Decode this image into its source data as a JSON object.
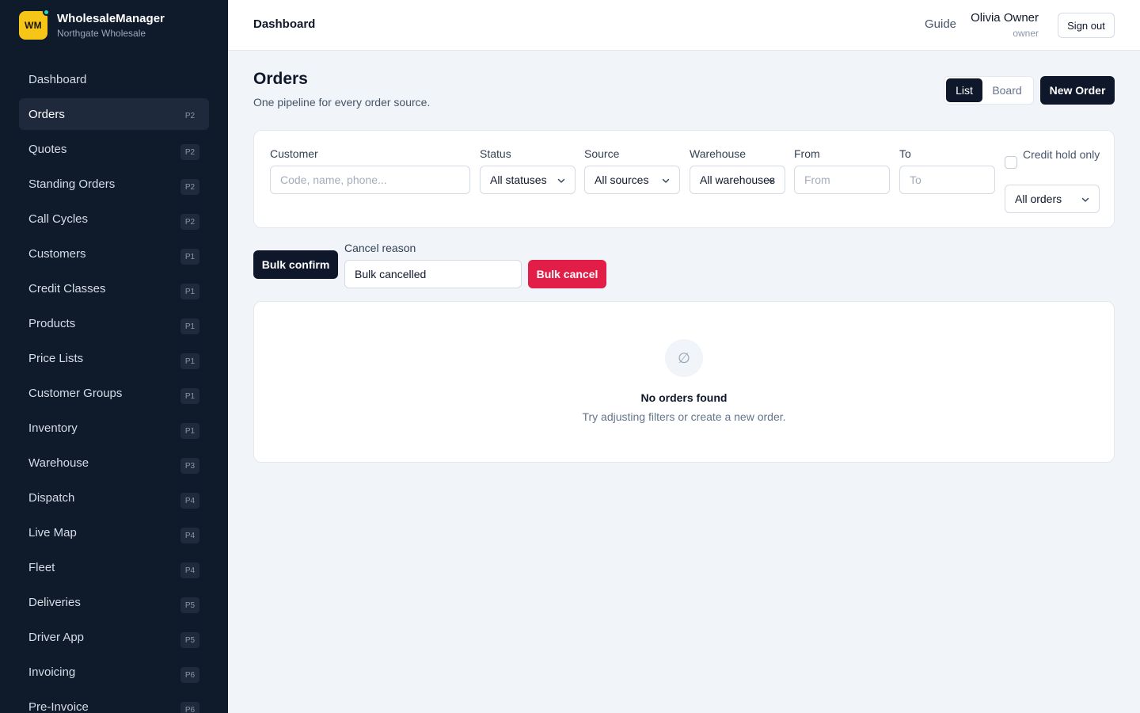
{
  "brand": {
    "logo_text": "WM",
    "name": "WholesaleManager",
    "subtitle": "Northgate Wholesale"
  },
  "sidebar": {
    "items": [
      {
        "label": "Dashboard",
        "badge": ""
      },
      {
        "label": "Orders",
        "badge": "P2",
        "active": true
      },
      {
        "label": "Quotes",
        "badge": "P2"
      },
      {
        "label": "Standing Orders",
        "badge": "P2"
      },
      {
        "label": "Call Cycles",
        "badge": "P2"
      },
      {
        "label": "Customers",
        "badge": "P1"
      },
      {
        "label": "Credit Classes",
        "badge": "P1"
      },
      {
        "label": "Products",
        "badge": "P1"
      },
      {
        "label": "Price Lists",
        "badge": "P1"
      },
      {
        "label": "Customer Groups",
        "badge": "P1"
      },
      {
        "label": "Inventory",
        "badge": "P1"
      },
      {
        "label": "Warehouse",
        "badge": "P3"
      },
      {
        "label": "Dispatch",
        "badge": "P4"
      },
      {
        "label": "Live Map",
        "badge": "P4"
      },
      {
        "label": "Fleet",
        "badge": "P4"
      },
      {
        "label": "Deliveries",
        "badge": "P5"
      },
      {
        "label": "Driver App",
        "badge": "P5"
      },
      {
        "label": "Invoicing",
        "badge": "P6"
      },
      {
        "label": "Pre-Invoice",
        "badge": "P6"
      }
    ]
  },
  "header": {
    "breadcrumb": "Dashboard",
    "guide_label": "Guide",
    "user_name": "Olivia Owner",
    "user_role": "owner",
    "signout_label": "Sign out"
  },
  "page": {
    "title": "Orders",
    "subtitle": "One pipeline for every order source.",
    "view_list": "List",
    "view_board": "Board",
    "new_order_label": "New Order"
  },
  "filters": {
    "customer_label": "Customer",
    "customer_placeholder": "Code, name, phone...",
    "status_label": "Status",
    "status_value": "All statuses",
    "source_label": "Source",
    "source_value": "All sources",
    "warehouse_label": "Warehouse",
    "warehouse_value": "All warehouses",
    "from_label": "From",
    "from_placeholder": "From",
    "to_label": "To",
    "to_placeholder": "To",
    "credit_hold_label": "Credit hold only",
    "credit_hold_checked": false,
    "orders_value": "All orders"
  },
  "bulk": {
    "confirm_label": "Bulk confirm",
    "reason_label": "Cancel reason",
    "reason_value": "Bulk cancelled",
    "cancel_label": "Bulk cancel"
  },
  "empty_state": {
    "icon": "empty-set-icon",
    "icon_glyph": "∅",
    "title": "No orders found",
    "message": "Try adjusting filters or create a new order."
  },
  "colors": {
    "sidebar_bg": "#0f1a2b",
    "brand_accent": "#f5c518",
    "primary": "#0f172a",
    "danger": "#e11d48",
    "page_bg": "#f1f4f8"
  }
}
